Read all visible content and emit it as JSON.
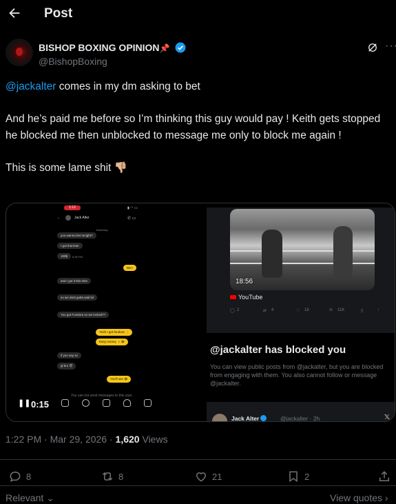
{
  "header": {
    "title": "Post"
  },
  "author": {
    "name": "BISHOP BOXING OPINION",
    "name_emoji": "📌",
    "handle": "@BishopBoxing"
  },
  "tweet": {
    "mention": "@jackalter",
    "line1_rest": " comes in my dm asking to bet",
    "para2": "And he’s paid me before so I’m thinking this guy would pay ! Keith gets stopped he blocked me then unblocked to message me only to block me again !",
    "para3": "This is some lame shit 👎🏼"
  },
  "media": {
    "video_time": "0:15",
    "phone": {
      "time": "1:12",
      "contact": "Jack Alter",
      "date_label": "Yesterday",
      "messages": [
        {
          "side": "left",
          "text": "you wanna bet tonight?"
        },
        {
          "side": "left",
          "text": "I got thurman"
        },
        {
          "side": "left",
          "text": "100$"
        },
        {
          "side": "left",
          "text": "6:36 PM"
        },
        {
          "side": "right",
          "text": "Bet !"
        },
        {
          "side": "left",
          "text": "and I got it this time"
        },
        {
          "side": "left",
          "text": "so we dont gotta wait lol"
        },
        {
          "side": "left",
          "text": "You got Fundora so we locked??"
        },
        {
          "side": "right",
          "text": "Yeah I got fundora 👍"
        },
        {
          "side": "right",
          "text": "Easy money 💰😂"
        },
        {
          "side": "left",
          "text": "if you say so"
        },
        {
          "side": "left",
          "text": "gl bro 😈"
        },
        {
          "side": "right",
          "text": "You'll see 😂"
        }
      ],
      "footer": "You can not send messages to this user."
    },
    "youtube": {
      "duration": "18:56",
      "brand": "YouTube",
      "stats": [
        "2",
        "4",
        "18",
        "11K"
      ]
    },
    "blocked_card": {
      "title": "@jackalter has blocked you",
      "description": "You can view public posts from @jackalter, but you are blocked from engaging with them. You also cannot follow or message @jackalter."
    },
    "jack_row": {
      "name": "Jack Alter",
      "handle": "@jackalter · 2h"
    }
  },
  "meta": {
    "time": "1:22 PM",
    "separator": " · ",
    "date": "Mar 29, 2026",
    "views_count": "1,620",
    "views_label": " Views"
  },
  "actions": {
    "replies": "8",
    "reposts": "8",
    "likes": "21",
    "bookmarks": "2"
  },
  "footer": {
    "sort": "Relevant",
    "view_quotes": "View quotes"
  },
  "colors": {
    "accent": "#1d9bf0",
    "muted": "#71767b",
    "text": "#e7e9ea",
    "background": "#000000",
    "border": "#2f3336"
  },
  "icons": [
    "back-arrow-icon",
    "verified-badge-icon",
    "grok-icon",
    "more-icon",
    "reply-icon",
    "repost-icon",
    "like-icon",
    "bookmark-icon",
    "share-icon",
    "chevron-down-icon",
    "chevron-right-icon",
    "youtube-icon"
  ]
}
